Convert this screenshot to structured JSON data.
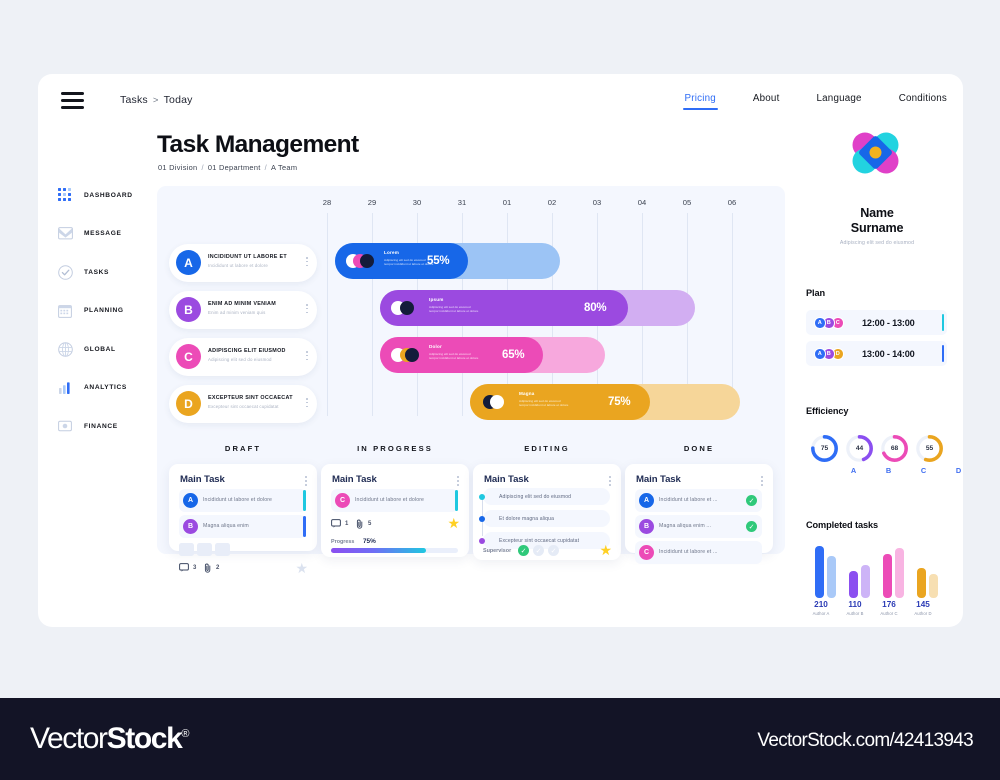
{
  "header": {
    "menu_icon": "hamburger-icon",
    "breadcrumb": {
      "root": "Tasks",
      "sep": ">",
      "current": "Today"
    },
    "nav": [
      {
        "label": "Pricing",
        "active": true
      },
      {
        "label": "About",
        "active": false
      },
      {
        "label": "Language",
        "active": false
      },
      {
        "label": "Conditions",
        "active": false
      }
    ]
  },
  "page": {
    "title": "Task Management",
    "sub": [
      "01 Division",
      "01 Department",
      "A Team"
    ],
    "sub_sep": "/"
  },
  "sidebar": {
    "items": [
      {
        "label": "DASHBOARD",
        "icon": "grid-dots-icon"
      },
      {
        "label": "MESSAGE",
        "icon": "envelope-icon"
      },
      {
        "label": "TASKS",
        "icon": "check-circle-icon"
      },
      {
        "label": "PLANNING",
        "icon": "calendar-icon"
      },
      {
        "label": "GLOBAL",
        "icon": "globe-icon"
      },
      {
        "label": "ANALYTICS",
        "icon": "bar-chart-icon"
      },
      {
        "label": "FINANCE",
        "icon": "coin-icon"
      }
    ]
  },
  "chart_data": [
    {
      "type": "bar",
      "name": "gantt-timeline",
      "title": "",
      "orientation": "horizontal",
      "categories": [
        "Lorem",
        "Ipsum",
        "Dolor",
        "Magna"
      ],
      "values": [
        55,
        80,
        65,
        75
      ],
      "value_labels": [
        "55%",
        "80%",
        "65%",
        "75%"
      ],
      "xlabel": "",
      "ylabel": "",
      "ticks": [
        "28",
        "29",
        "30",
        "31",
        "01",
        "02",
        "03",
        "04",
        "05",
        "06"
      ],
      "grid": true,
      "series": [
        {
          "name": "Lorem",
          "percent": 55,
          "start_tick": "28",
          "end_tick": "02",
          "color": "#1767e8",
          "track": "#9cc4f5"
        },
        {
          "name": "Ipsum",
          "percent": 80,
          "start_tick": "29",
          "end_tick": "04",
          "color": "#9b4ae0",
          "track": "#d2aef2"
        },
        {
          "name": "Dolor",
          "percent": 65,
          "start_tick": "29",
          "end_tick": "03",
          "color": "#ec4bb7",
          "track": "#f7a8dd"
        },
        {
          "name": "Magna",
          "percent": 75,
          "start_tick": "31",
          "end_tick": "05",
          "color": "#eaa520",
          "track": "#f6d699"
        }
      ],
      "bar_desc": "Adipiscing elit sed do eiusmod tempor incididunt ut labore et dolore"
    },
    {
      "type": "bar",
      "name": "completed-tasks",
      "title": "Completed tasks",
      "categories": [
        "Author A",
        "Author B",
        "Author C",
        "Author D"
      ],
      "values": [
        210,
        110,
        176,
        145
      ],
      "xlabel": "",
      "ylabel": "",
      "grid": false,
      "series": [
        {
          "name": "primary",
          "values": [
            210,
            110,
            176,
            145
          ]
        },
        {
          "name": "secondary",
          "values": [
            168,
            92,
            198,
            118
          ]
        }
      ],
      "colors": [
        "#2f6df6",
        "#8b4ff0",
        "#ec4bb7",
        "#eaa520"
      ],
      "colors_light": [
        "#a9c9f8",
        "#cdb4f7",
        "#f8b4e2",
        "#f7dfb2"
      ]
    },
    {
      "type": "pie",
      "name": "efficiency-donuts",
      "title": "Efficiency",
      "categories": [
        "A",
        "B",
        "C",
        "D"
      ],
      "values": [
        75,
        44,
        68,
        55
      ],
      "colors": [
        "#2f6df6",
        "#8b4ff0",
        "#ec4bb7",
        "#eaa520"
      ],
      "ylim": [
        0,
        100
      ]
    }
  ],
  "gantt": {
    "dates": [
      "28",
      "29",
      "30",
      "31",
      "01",
      "02",
      "03",
      "04",
      "05",
      "06"
    ],
    "tasks": [
      {
        "letter": "A",
        "title": "INCIDIDUNT UT LABORE ET",
        "sub": "Incididunt ut labore et dolore",
        "color": "#1767e8"
      },
      {
        "letter": "B",
        "title": "ENIM AD MINIM VENIAM",
        "sub": "Enim ad minim veniam quis",
        "color": "#9b4ae0"
      },
      {
        "letter": "C",
        "title": "ADIPISCING ELIT EIUSMOD",
        "sub": "Adipiscing elit sed do eiusmod",
        "color": "#ec4bb7"
      },
      {
        "letter": "D",
        "title": "EXCEPTEUR SINT OCCAECAT",
        "sub": "Excepteur sint occaecat cupidatat",
        "color": "#eaa520"
      }
    ]
  },
  "kanban": {
    "columns": [
      {
        "title": "DRAFT"
      },
      {
        "title": "IN PROGRESS"
      },
      {
        "title": "EDITING"
      },
      {
        "title": "DONE"
      }
    ],
    "card_title": "Main Task",
    "draft": {
      "subtasks": [
        {
          "letter": "A",
          "text": "Incididunt ut labore et dolore",
          "color": "#1767e8",
          "accent": "#1fc8e0"
        },
        {
          "letter": "B",
          "text": "Magna aliqua enim",
          "color": "#9b4ae0",
          "accent": "#2f6df6"
        }
      ],
      "comments": "3",
      "attachments": "2",
      "comment_icon": "comment-icon",
      "attach_icon": "paperclip-icon",
      "star_icon": "star-icon"
    },
    "in_progress": {
      "subtasks": [
        {
          "letter": "C",
          "text": "Incididunt ut labore et dolore",
          "color": "#ec4bb7",
          "accent": "#1fc8e0"
        }
      ],
      "comments": "1",
      "attachments": "5",
      "progress_label": "Progress",
      "progress_value": "75%",
      "progress_percent": 75,
      "star_icon": "star-icon"
    },
    "editing": {
      "steps": [
        {
          "text": "Adipiscing elit sed do eiusmod",
          "color": "#1fc8e0"
        },
        {
          "text": "Et dolore magna aliqua",
          "color": "#1767e8"
        },
        {
          "text": "Excepteur sint occaecat cupidatat",
          "color": "#9b4ae0"
        }
      ],
      "supervisor_label": "Supervisor",
      "checks": [
        true,
        false,
        false
      ],
      "star_icon": "star-icon"
    },
    "done": {
      "subtasks": [
        {
          "letter": "A",
          "text": "Incididunt ut labore et ...",
          "color": "#1767e8",
          "done": true
        },
        {
          "letter": "B",
          "text": "Magna aliqua enim ...",
          "color": "#9b4ae0",
          "done": true
        },
        {
          "letter": "C",
          "text": "Incididunt ut labore et ...",
          "color": "#ec4bb7",
          "done": false
        }
      ]
    }
  },
  "profile": {
    "logo_icon": "flower-logo-icon",
    "name": "Name\nSurname",
    "name_line1": "Name",
    "name_line2": "Surname",
    "sub": "Adipiscing elit sed do eiusmod"
  },
  "plan": {
    "title": "Plan",
    "rows": [
      {
        "avatars": [
          "A",
          "B",
          "C"
        ],
        "avatar_colors": [
          "#2f6df6",
          "#9b4ae0",
          "#ec4bb7"
        ],
        "time": "12:00 - 13:00",
        "mark": "#1fc8e0"
      },
      {
        "avatars": [
          "A",
          "B",
          "D"
        ],
        "avatar_colors": [
          "#2f6df6",
          "#9b4ae0",
          "#eaa520"
        ],
        "time": "13:00 - 14:00",
        "mark": "#2f6df6"
      }
    ]
  },
  "efficiency": {
    "title": "Efficiency",
    "items": [
      {
        "label": "A",
        "value": "75",
        "percent": 75,
        "color": "#2f6df6"
      },
      {
        "label": "B",
        "value": "44",
        "percent": 44,
        "color": "#8b4ff0"
      },
      {
        "label": "C",
        "value": "68",
        "percent": 68,
        "color": "#ec4bb7"
      },
      {
        "label": "D",
        "value": "55",
        "percent": 55,
        "color": "#eaa520"
      }
    ]
  },
  "completed": {
    "title": "Completed tasks",
    "items": [
      {
        "value": "210",
        "author": "Author A",
        "h1": 52,
        "h2": 42,
        "c1": "#2f6df6",
        "c2": "#a9c9f8"
      },
      {
        "value": "110",
        "author": "Author B",
        "h1": 27,
        "h2": 33,
        "c1": "#8b4ff0",
        "c2": "#cdb4f7"
      },
      {
        "value": "176",
        "author": "Author C",
        "h1": 44,
        "h2": 50,
        "c1": "#ec4bb7",
        "c2": "#f8b4e2"
      },
      {
        "value": "145",
        "author": "Author D",
        "h1": 30,
        "h2": 24,
        "c1": "#eaa520",
        "c2": "#f7dfb2"
      }
    ]
  },
  "watermark": {
    "brand_a": "Vector",
    "brand_b": "Stock",
    "reg": "®",
    "url": "VectorStock.com/42413943"
  }
}
